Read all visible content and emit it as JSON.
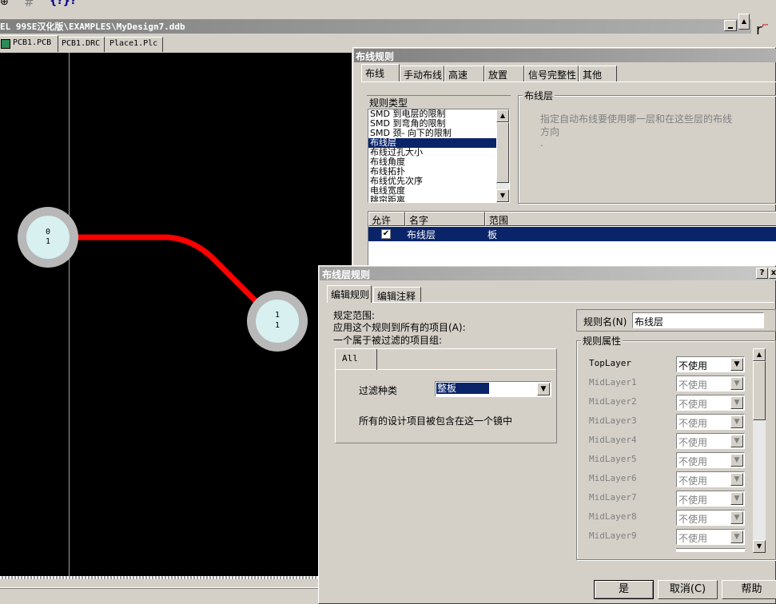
{
  "app": {
    "toolbar_glyphs": [
      "⊕",
      "#",
      "{?}?"
    ],
    "path_title": "EL 99SE汉化版\\EXAMPLES\\MyDesign7.ddb",
    "doc_tabs": [
      "PCB1.PCB",
      "PCB1.DRC",
      "Place1.Plc"
    ]
  },
  "pcb": {
    "pad1": [
      "0",
      "1"
    ],
    "pad2": [
      "1",
      "1"
    ],
    "track_color": "#ff0000",
    "pad_ring_color": "#b8b8b8",
    "pad_inner_color": "#d8f0f0"
  },
  "routing_rules": {
    "title": "布线规则",
    "tabs": [
      "布线",
      "手动布线",
      "高速",
      "放置",
      "信号完整性",
      "其他"
    ],
    "rule_type_label": "规则类型",
    "rule_types": [
      "SMD 到电层的限制",
      "SMD 到弯角的限制",
      "SMD 颈- 向下的限制",
      "布线层",
      "布线过孔大小",
      "布线角度",
      "布线拓扑",
      "布线优先次序",
      "电线宽度",
      "跳帘距离"
    ],
    "selected_rule_type": "布线层",
    "desc_group_label": "布线层",
    "description": "指定自动布线要使用哪一层和在这些层的布线方向",
    "desc_dot": ".",
    "table_headers": [
      "允许",
      "名字",
      "范围"
    ],
    "table_rows": [
      {
        "enabled": true,
        "name": "布线层",
        "scope": "板"
      }
    ]
  },
  "layer_rule": {
    "title": "布线层规则",
    "help_glyph": "?",
    "close_glyph": "x",
    "tabs": [
      "编辑规则",
      "编辑注释"
    ],
    "scope_text_1": "规定范围:",
    "scope_text_2": "应用这个规则到所有的项目(A):",
    "scope_text_3": "一个属于被过滤的项目组:",
    "filter_tab": "All",
    "filter_kind_label": "过滤种类",
    "filter_kind_value": "整板",
    "filter_desc": "所有的设计项目被包含在这一个镜中",
    "rule_name_label": "规则名(N)",
    "rule_name_value": "布线层",
    "props_label": "规则属性",
    "layers": [
      {
        "name": "TopLayer",
        "value": "不使用",
        "enabled": true
      },
      {
        "name": "MidLayer1",
        "value": "不使用",
        "enabled": false
      },
      {
        "name": "MidLayer2",
        "value": "不使用",
        "enabled": false
      },
      {
        "name": "MidLayer3",
        "value": "不使用",
        "enabled": false
      },
      {
        "name": "MidLayer4",
        "value": "不使用",
        "enabled": false
      },
      {
        "name": "MidLayer5",
        "value": "不使用",
        "enabled": false
      },
      {
        "name": "MidLayer6",
        "value": "不使用",
        "enabled": false
      },
      {
        "name": "MidLayer7",
        "value": "不使用",
        "enabled": false
      },
      {
        "name": "MidLayer8",
        "value": "不使用",
        "enabled": false
      },
      {
        "name": "MidLayer9",
        "value": "不使用",
        "enabled": false
      }
    ],
    "ok_button": "是",
    "cancel_button": "取消(C)",
    "help_button": "帮助"
  }
}
